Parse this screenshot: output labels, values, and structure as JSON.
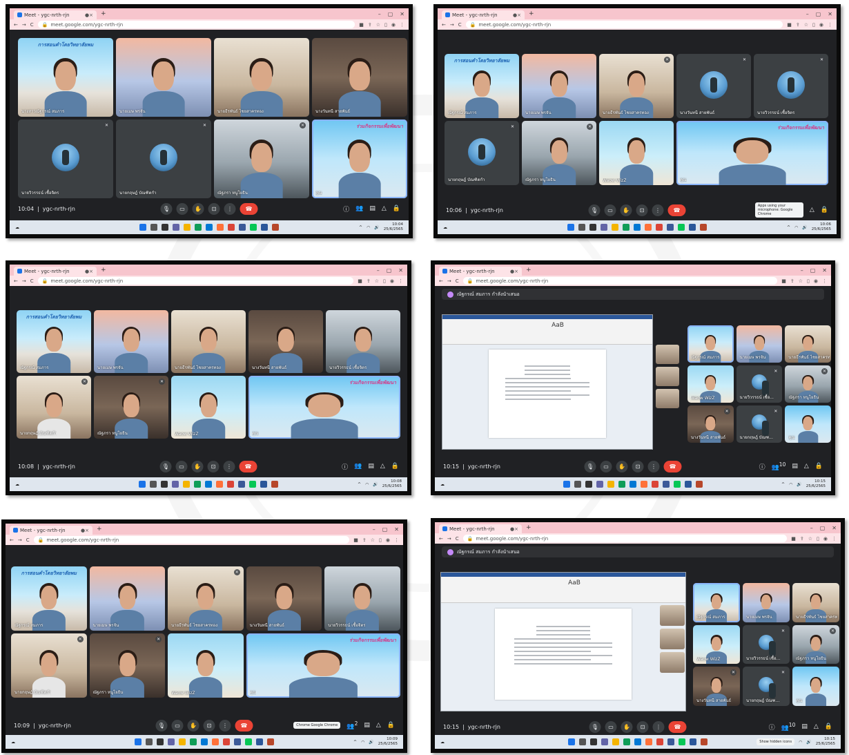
{
  "meeting_code": "ygc-nrth-rjn",
  "browser": {
    "tab_title": "Meet - ygc-nrth-rjn",
    "url": "meet.google.com/ygc-nrth-rjn"
  },
  "banner_text": "การสอนคำโดยวิทยาลัยพม",
  "banner_text_right": "ร่วมกิจกรรมเพื่อพัฒนา",
  "presenter_label": "ณัฐกรณ์ สมภาร กำลังนำเสนอ",
  "tooltip_mic": "Apps using your microphone: Google Chrome",
  "tooltip_sm": "Chrome Google Chrome",
  "tooltip_hidden": "Show hidden icons",
  "badge_2": "2",
  "badge_10": "10",
  "screens": [
    {
      "time": "10:04",
      "tb_time": "10:04",
      "tb_date": "25/6/2565",
      "tiles": [
        {
          "name": "นางสาวณัฐกรณ์ สมภาร"
        },
        {
          "name": "นายเมษ พรจัน"
        },
        {
          "name": "นายธีรพันธ์ ไชยสาครทอง"
        },
        {
          "name": "นางวันทนี สายพันธ์"
        },
        {
          "name": "นายวิวรรธน์ เชื้อจิตร"
        },
        {
          "name": "นายกฤษฎ์ บัณฑิตกำ"
        },
        {
          "name": "ณัฐภรา หนูโยธิน"
        },
        {
          "name": "คุณ"
        }
      ]
    },
    {
      "time": "10:06",
      "tb_time": "10:06",
      "tb_date": "25/6/2565",
      "tiles": [
        {
          "name": "ณัฐกรณ์ สมภาร"
        },
        {
          "name": "นายเมษ พรจัน"
        },
        {
          "name": "นายธีรพันธ์ ไชยสาครทอง"
        },
        {
          "name": "นางวันทนี สายพันธ์"
        },
        {
          "name": "นายวิวรรธน์ เชื้อจิตร"
        },
        {
          "name": "นายกฤษฎ์ บัณฑิตกำ"
        },
        {
          "name": "ณัฐภรา หนูโยธิน"
        },
        {
          "name": "Waow WizZ"
        },
        {
          "name": "คุณ"
        }
      ]
    },
    {
      "time": "10:08",
      "tb_time": "10:08",
      "tb_date": "25/6/2565",
      "tiles": [
        {
          "name": "ณัฐกรณ์ สมภาร"
        },
        {
          "name": "นายเมษ พรจัน"
        },
        {
          "name": "นายธีรพันธ์ ไชยสาครทอง"
        },
        {
          "name": "นางวันทนี สายพันธ์"
        },
        {
          "name": "นายวิวรรธน์ เชื้อจิตร"
        },
        {
          "name": "นายกฤษฎ์ บัณฑิตกำ"
        },
        {
          "name": "ณัฐภรา หนูโยธิน"
        },
        {
          "name": "Waow WizZ"
        },
        {
          "name": "คุณ"
        }
      ]
    },
    {
      "time": "10:15",
      "tb_time": "10:15",
      "tb_date": "25/6/2565",
      "tiles": [
        {
          "name": "ณัฐกรณ์ สมภาร"
        },
        {
          "name": "นายเมษ พรจัน"
        },
        {
          "name": "นายธีรพันธ์ ไชยสาครทอง"
        },
        {
          "name": "Waow WizZ"
        },
        {
          "name": "นายวิวรรธน์ เชื้อ..."
        },
        {
          "name": "ณัฐภรา หนูโยธิน"
        },
        {
          "name": "นางวันทนี สายพันธ์"
        },
        {
          "name": "นายกฤษฎ์ บัณฑ..."
        },
        {
          "name": "คุณ"
        }
      ]
    },
    {
      "time": "10:09",
      "tb_time": "10:09",
      "tb_date": "25/6/2565",
      "tiles": [
        {
          "name": "ณัฐกรณ์ สมภาร"
        },
        {
          "name": "นายเมษ พรจัน"
        },
        {
          "name": "นายธีรพันธ์ ไชยสาครทอง"
        },
        {
          "name": "นางวันทนี สายพันธ์"
        },
        {
          "name": "นายวิวรรธน์ เชื้อจิตร"
        },
        {
          "name": "นายกฤษฎ์ บัณฑิตกำ"
        },
        {
          "name": "ณัฐภรา หนูโยธิน"
        },
        {
          "name": "Waow WizZ"
        },
        {
          "name": "คุณ"
        }
      ]
    },
    {
      "time": "10:15",
      "tb_time": "10:15",
      "tb_date": "25/6/2565",
      "tiles": [
        {
          "name": "ณัฐกรณ์ สมภาร"
        },
        {
          "name": "นายเมษ พรจัน"
        },
        {
          "name": "นายธีรพันธ์ ไชยสาครทอง"
        },
        {
          "name": "Waow WizZ"
        },
        {
          "name": "นายวิวรรธน์ เชื้อ..."
        },
        {
          "name": "ณัฐภรา หนูโยธิน"
        },
        {
          "name": "นางวันทนี สายพันธ์"
        },
        {
          "name": "นายกฤษฎ์ บัณฑ..."
        },
        {
          "name": "คุณ"
        }
      ]
    }
  ],
  "colors": {
    "meet_bg": "#202124",
    "tile_bg": "#3c4043",
    "tab_pink": "#f7c5cd",
    "end_call_red": "#ea4335",
    "active_speaker": "#8ab4f8"
  },
  "icons": {
    "mic": "microphone-icon",
    "camera": "camera-icon",
    "hand": "raise-hand-icon",
    "present": "present-screen-icon",
    "more": "more-vert-icon",
    "end": "end-call-icon",
    "info": "info-icon",
    "people": "people-icon",
    "chat": "chat-icon",
    "activities": "activities-icon",
    "lock": "host-controls-icon"
  }
}
